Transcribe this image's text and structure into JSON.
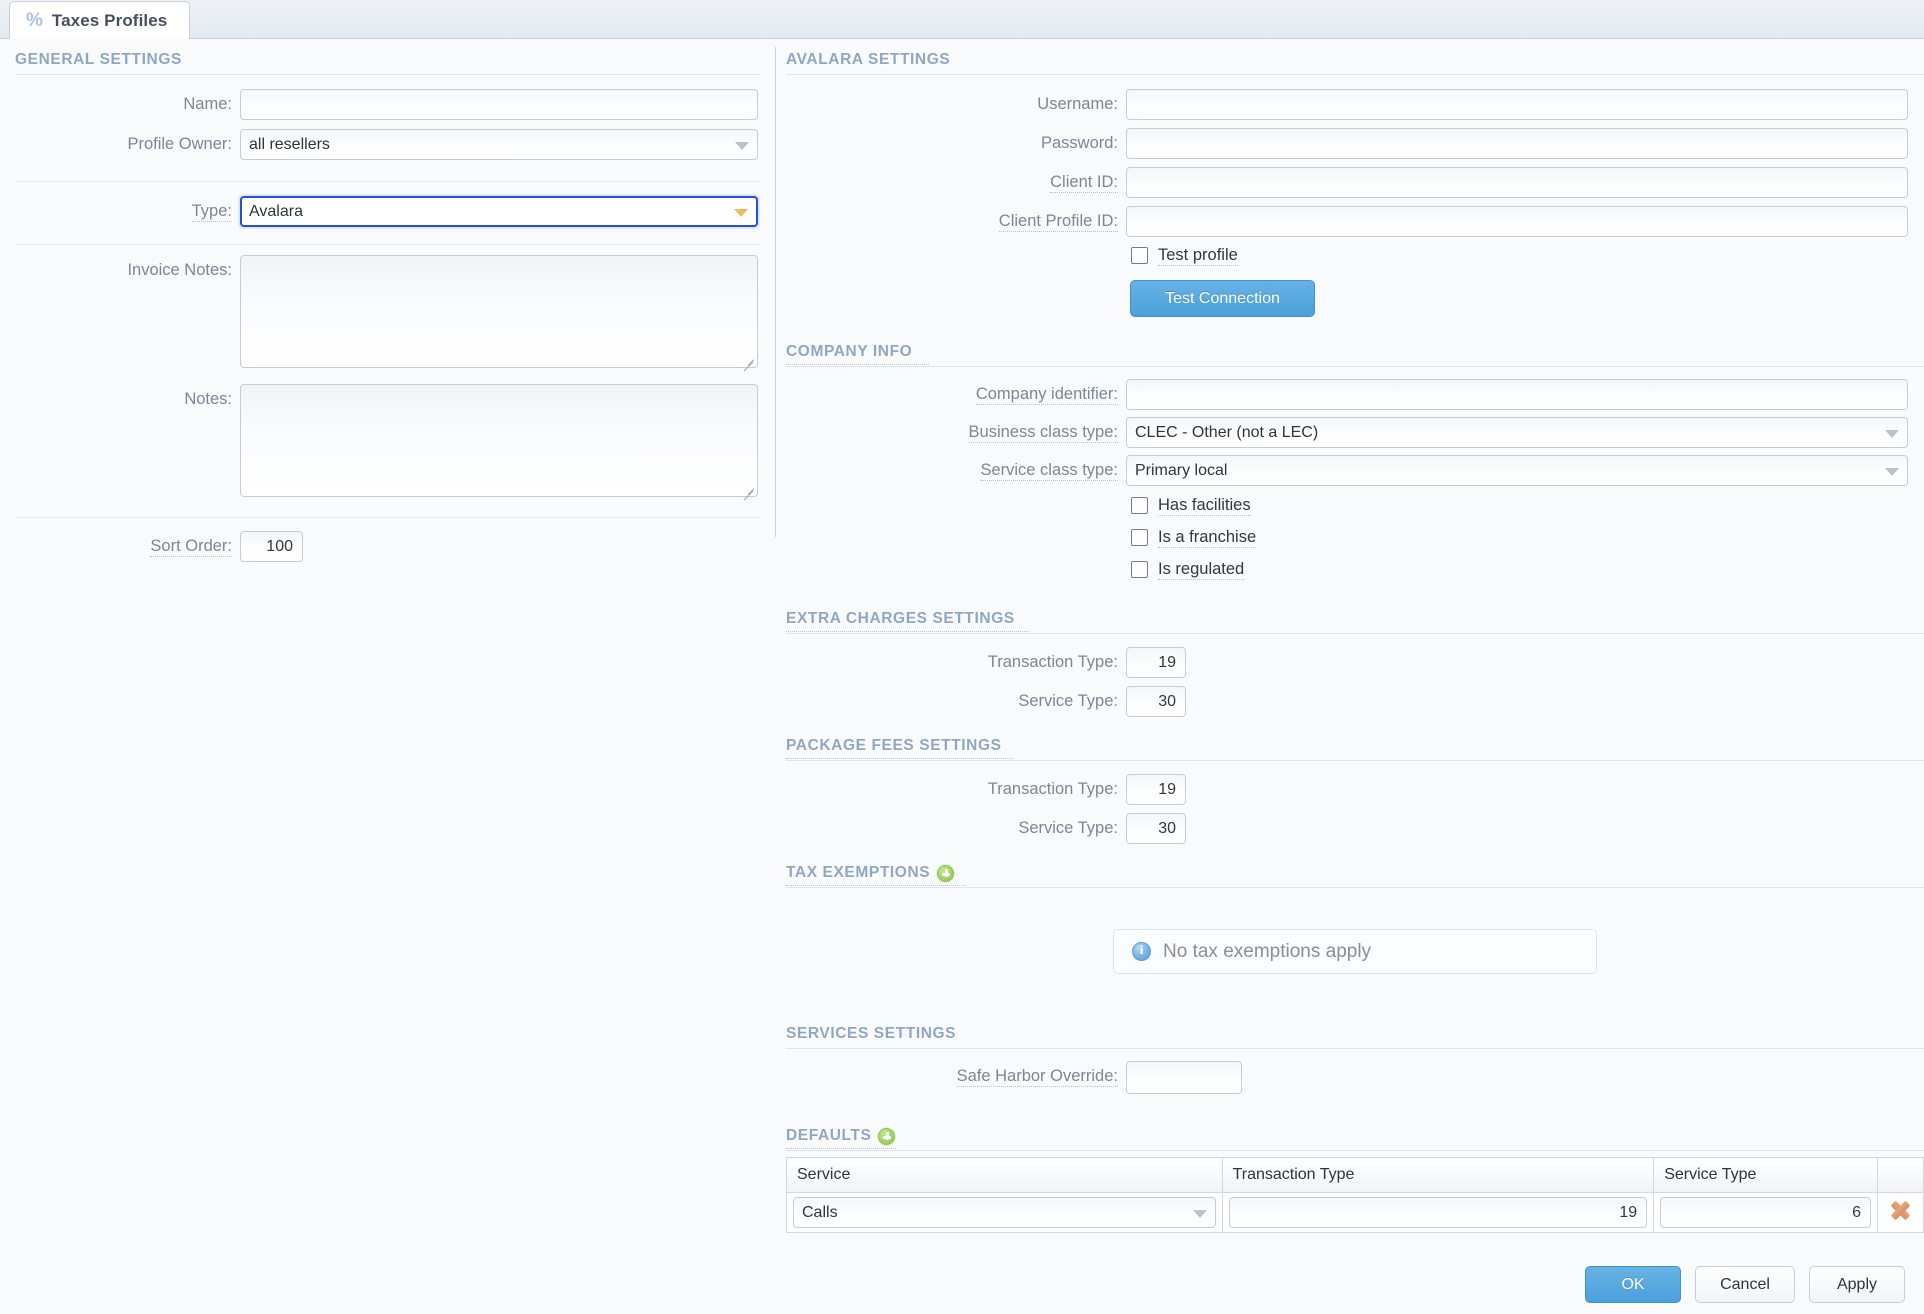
{
  "window": {
    "tab_label": "Taxes Profiles",
    "tab_icon": "percent-icon"
  },
  "general_settings": {
    "heading": "GENERAL SETTINGS",
    "name": {
      "label": "Name:",
      "value": ""
    },
    "profile_owner": {
      "label": "Profile Owner:",
      "value": "all resellers"
    },
    "type": {
      "label": "Type:",
      "value": "Avalara"
    },
    "invoice_notes": {
      "label": "Invoice Notes:",
      "value": ""
    },
    "notes": {
      "label": "Notes:",
      "value": ""
    },
    "sort_order": {
      "label": "Sort Order:",
      "value": "100"
    }
  },
  "avalara_settings": {
    "heading": "AVALARA SETTINGS",
    "username": {
      "label": "Username:",
      "value": ""
    },
    "password": {
      "label": "Password:",
      "value": ""
    },
    "client_id": {
      "label": "Client ID:",
      "value": ""
    },
    "client_profile_id": {
      "label": "Client Profile ID:",
      "value": ""
    },
    "test_profile": {
      "label": "Test profile",
      "checked": false
    },
    "test_connection_button": "Test Connection"
  },
  "company_info": {
    "heading": "COMPANY INFO",
    "company_identifier": {
      "label": "Company identifier:",
      "value": ""
    },
    "business_class_type": {
      "label": "Business class type:",
      "value": "CLEC - Other (not a LEC)"
    },
    "service_class_type": {
      "label": "Service class type:",
      "value": "Primary local"
    },
    "has_facilities": {
      "label": "Has facilities",
      "checked": false
    },
    "is_a_franchise": {
      "label": "Is a franchise",
      "checked": false
    },
    "is_regulated": {
      "label": "Is regulated",
      "checked": false
    }
  },
  "extra_charges_settings": {
    "heading": "EXTRA CHARGES SETTINGS",
    "transaction_type": {
      "label": "Transaction Type:",
      "value": "19"
    },
    "service_type": {
      "label": "Service Type:",
      "value": "30"
    }
  },
  "package_fees_settings": {
    "heading": "PACKAGE FEES SETTINGS",
    "transaction_type": {
      "label": "Transaction Type:",
      "value": "19"
    },
    "service_type": {
      "label": "Service Type:",
      "value": "30"
    }
  },
  "tax_exemptions": {
    "heading": "TAX EXEMPTIONS",
    "add_icon": "plus-circle-icon",
    "empty_message": "No tax exemptions apply",
    "empty_icon": "info-icon"
  },
  "services_settings": {
    "heading": "SERVICES SETTINGS",
    "safe_harbor_override": {
      "label": "Safe Harbor Override:",
      "value": ""
    }
  },
  "defaults": {
    "heading": "DEFAULTS",
    "add_icon": "plus-circle-icon",
    "columns": [
      "Service",
      "Transaction Type",
      "Service Type",
      ""
    ],
    "rows": [
      {
        "service": "Calls",
        "transaction_type": "19",
        "service_type": "6",
        "delete_icon": "delete-x-icon"
      }
    ]
  },
  "footer": {
    "ok": "OK",
    "cancel": "Cancel",
    "apply": "Apply"
  },
  "colors": {
    "accent_blue": "#4ba0dc",
    "section_heading": "#8fa6c4",
    "focus_border": "#2952c8",
    "focus_arrow": "#edbc5b",
    "add_green": "#8cc455",
    "delete_orange": "#da8f62"
  }
}
